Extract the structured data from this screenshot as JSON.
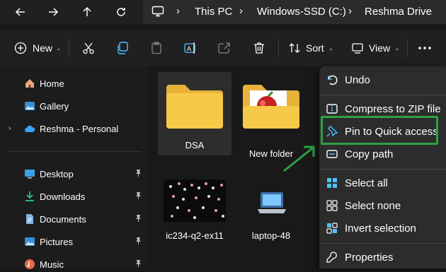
{
  "breadcrumb": {
    "items": [
      "This PC",
      "Windows-SSD (C:)",
      "Reshma Drive"
    ]
  },
  "toolbar": {
    "new_label": "New",
    "sort_label": "Sort",
    "view_label": "View"
  },
  "sidebar": {
    "top": [
      "Home",
      "Gallery",
      "Reshma - Personal"
    ],
    "quick": [
      "Desktop",
      "Downloads",
      "Documents",
      "Pictures",
      "Music"
    ]
  },
  "files": [
    {
      "name": "DSA"
    },
    {
      "name": "New folder"
    },
    {
      "name": "ic234-q2-ex11"
    },
    {
      "name": "laptop-48"
    }
  ],
  "context_menu": {
    "items": [
      "Undo",
      "Compress to ZIP file",
      "Pin to Quick access",
      "Copy path",
      "Select all",
      "Select none",
      "Invert selection",
      "Properties"
    ],
    "highlighted": "Pin to Quick access",
    "highlight_color": "#2ea043"
  },
  "colors": {
    "accent": "#4cc2ff",
    "folder": "#f7c948"
  }
}
